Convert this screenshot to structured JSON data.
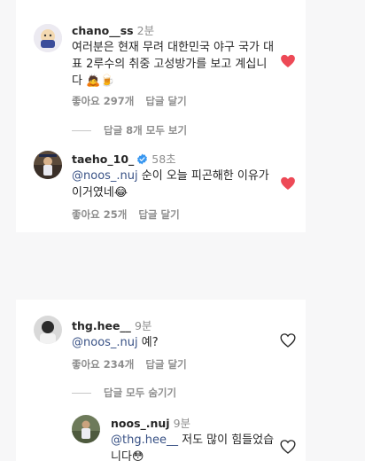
{
  "colors": {
    "like_red": "#ed4956",
    "mention_blue": "#385185",
    "verified_blue": "#3897f0",
    "meta_gray": "#8e8e8e"
  },
  "comments": [
    {
      "username": "chano__ss",
      "time": "2분",
      "text": "여러분은 현재 무려 대한민국 야구 국가 대표 2루수의 취중 고성방가를 보고 계십니다",
      "emoji": "🙇🍺",
      "likes": "좋아요 297개",
      "reply": "답글 달기",
      "liked": true,
      "view_replies": "답글 8개 모두 보기"
    },
    {
      "username": "taeho_10_",
      "verified": true,
      "verified_icon": "verified-badge-icon",
      "time": "58초",
      "mention": "@noos_.nuj",
      "text": "순이 오늘 피곤해한 이유가 이거였네",
      "emoji": "😂",
      "likes": "좋아요 25개",
      "reply": "답글 달기",
      "liked": true
    },
    {
      "username": "thg.hee__",
      "time": "9분",
      "mention": "@noos_.nuj",
      "text": "예?",
      "likes": "좋아요 234개",
      "reply": "답글 달기",
      "liked": false,
      "hide_replies": "답글 모두 숨기기"
    },
    {
      "username": "noos_.nuj",
      "time": "9분",
      "mention": "@thg.hee__",
      "text": "저도 많이 힘들었습니다",
      "emoji": "😳",
      "liked": false
    }
  ]
}
